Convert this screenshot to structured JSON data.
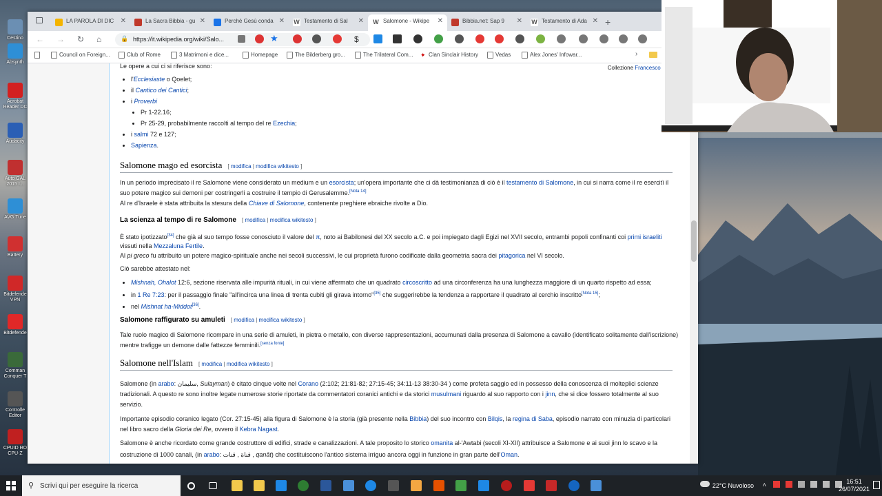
{
  "desktop": {
    "icons": [
      {
        "label": "Cestino",
        "color": "#6b8fb3"
      },
      {
        "label": "Absynth",
        "color": "#2e8fd6"
      },
      {
        "label": "Acrobat Reader DC",
        "color": "#d32020"
      },
      {
        "label": "Audacity",
        "color": "#2b5fb5"
      },
      {
        "label": "Auto GAL 2015 I...",
        "color": "#c03030"
      },
      {
        "label": "AVG Tune",
        "color": "#2e8fd6"
      },
      {
        "label": "Battery",
        "color": "#d03030"
      },
      {
        "label": "Bitdefende VPN",
        "color": "#d02828"
      },
      {
        "label": "Bitdefende",
        "color": "#e02828"
      },
      {
        "label": "Comman Conquer T",
        "color": "#3a6a3a"
      },
      {
        "label": "Controlle Editor",
        "color": "#555555"
      },
      {
        "label": "CPUID RO CPU-Z",
        "color": "#c02020"
      }
    ]
  },
  "browser": {
    "tabs": [
      {
        "title": "LA PAROLA DI DIC",
        "color": "#f4b400"
      },
      {
        "title": "La Sacra Bibbia - gu",
        "color": "#c0392b"
      },
      {
        "title": "Perché Gesù conda",
        "color": "#1a73e8"
      },
      {
        "title": "Testamento di Sal",
        "color": "#555555"
      },
      {
        "title": "Salomone - Wikipe",
        "color": "#555555"
      },
      {
        "title": "Bibbia.net: Sap 9",
        "color": "#c0392b"
      },
      {
        "title": "Testamento di Ada",
        "color": "#555555"
      }
    ],
    "new_tab": "+",
    "url": "https://it.wikipedia.org/wiki/Salo...",
    "bookmarks": [
      "Council on Foreign...",
      "Club of Rome",
      "3 Matrimoni e dice...",
      "Homepage",
      "The Bilderberg gro...",
      "The Trilateral Com...",
      "Clan Sinclair History",
      "Vedas",
      "Alex Jones' Infowar..."
    ]
  },
  "article": {
    "credit_prefix": "Collezione ",
    "credit_link": "Francesco Paolo Fron",
    "intro": "Le opere a cui ci si riferisce sono:",
    "list": [
      {
        "pre": "l'",
        "link": "Ecclesiaste",
        "post": " o Qoelet;"
      },
      {
        "pre": "il ",
        "link": "Cantico dei Cantici",
        "post": ";"
      },
      {
        "pre": "i ",
        "link": "Proverbi",
        "post": ""
      },
      {
        "pre": "i ",
        "link": "salmi",
        "post": " 72 e 127;"
      },
      {
        "pre": "",
        "link": "Sapienza",
        "post": "."
      }
    ],
    "sublist": [
      "Pr 1-22.16;",
      "Pr 25-29, probabilmente raccolti al tempo del re "
    ],
    "sublink": "Ezechia",
    "edit": "modifica",
    "edit2": "modifica wikitesto",
    "s1_title": "Salomone mago ed esorcista",
    "s1_p1a": "In un periodo imprecisato il re Salomone viene considerato un medium e un ",
    "s1_p1l": "esorcista",
    "s1_p1b": "; un'opera importante che ci dà testimonianza di ciò è il ",
    "s1_p1l2": "testamento di Salomone",
    "s1_p1c": ", in cui si narra come il re esercitì il suo potere magico sui demoni per costringerli a costruire il tempio di Gerusalemme.",
    "s1_n1": "[Nota 14]",
    "s1_p2a": "Al re d'Israele è stata attribuita la stesura della ",
    "s1_p2l": "Chiave di Salomone",
    "s1_p2b": ", contenente preghiere ebraiche rivolte a Dio.",
    "s2_title": "La scienza al tempo di re Salomone",
    "s2_p1a": "È stato ipotizzato",
    "s2_n1": "[34]",
    "s2_p1b": " che già al suo tempo fosse conosciuto il valore del ",
    "s2_pi": "π",
    "s2_p1c": ", noto ai Babilonesi del XX secolo a.C. e poi impiegato dagli Egizi nel XVII secolo, entrambi popoli confinanti coi ",
    "s2_l1": "primi israeliti",
    "s2_p1d": " vissuti nella ",
    "s2_l2": "Mezzaluna Fertile",
    "s2_p2a": "Al ",
    "s2_p2i": "pi greco",
    "s2_p2b": " fu attribuito un potere magico-spirituale anche nei secoli successivi, le cui proprietà furono codificate dalla geometria sacra dei ",
    "s2_l3": "pitagorica",
    "s2_p2c": " nel VI secolo.",
    "s2_p3": "Ciò sarebbe attestato nel:",
    "s2_i1l": "Mishnah, Ohalot",
    "s2_i1": " 12:6, sezione riservata alle impurità rituali, in cui viene affermato che un quadrato ",
    "s2_i1l2": "circoscritto",
    "s2_i1b": " ad una circonferenza ha una lunghezza maggiore di un quarto rispetto ad essa;",
    "s2_i2a": "in ",
    "s2_i2l": "1 Re 7:23",
    "s2_i2b": ": per il passaggio finale \"all'incirca una linea di trenta cubiti gli girava intorno\"",
    "s2_n2": "[35]",
    "s2_i2c": " che suggerirebbe la tendenza a rapportare il quadrato al cerchio inscritto",
    "s2_n3": "[Nota 15]",
    "s2_i3a": "nel ",
    "s2_i3l": "Mishnat ha-Middot",
    "s2_n4": "[36]",
    "s3_title": "Salomone raffigurato su amuleti",
    "s3_p": "Tale ruolo magico di Salomone ricompare in una serie di amuleti, in pietra o metallo, con diverse rappresentazioni, accumunati dalla presenza di Salomone a cavallo (identificato solitamente dall'iscrizione) mentre trafigge un demone dalle fattezze femminili.",
    "s3_n": "[senza fonte]",
    "s4_title": "Salomone nell'Islam",
    "s4_p1a": "Salomone (in ",
    "s4_l1": "arabo",
    "s4_p1ar": ": سليمان, ",
    "s4_p1i": "Sulayman",
    "s4_p1b": ") è citato cinque volte nel ",
    "s4_l2": "Corano",
    "s4_p1c": " (2:102; 21:81-82; 27:15-45; 34:11-13 38:30-34 ) come profeta saggio ed in possesso della conoscenza di molteplici scienze tradizionali. A questo re sono inoltre legate numerose storie riportate da commentatori coranici antichi e da storici ",
    "s4_l3": "musulmani",
    "s4_p1d": " riguardo al suo rapporto con i ",
    "s4_l4": "jinn",
    "s4_p1e": ", che si dice fossero totalmente al suo servizio.",
    "s4_p2a": "Importante episodio coranico legato (Cor. 27:15-45) alla figura di Salomone è la storia (già presente nella ",
    "s4_l5": "Bibbia",
    "s4_p2b": ") del suo incontro con ",
    "s4_l6": "Bilqis",
    "s4_p2c": ", la ",
    "s4_l7": "regina di Saba",
    "s4_p2d": ", episodio narrato con minuzia di particolari nel libro sacro della ",
    "s4_p2i": "Gloria dei Re",
    "s4_p2e": ", ovvero il ",
    "s4_l8": "Kebra Nagast",
    "s4_p3a": "Salomone è anche ricordato come grande costruttore di edifici, strade e canalizzazioni. A tale proposito lo storico ",
    "s4_l9": "omanita",
    "s4_p3b": " al-'Awtabi (secoli XI-XII) attribuisce a Salomone e ai suoi jinn lo scavo e la costruzione di 1000 canali, (in ",
    "s4_p3ar": ": قناة , قنات , ",
    "s4_p3i": "qanāt",
    "s4_p3c": ") che costituiscono l'antico sistema irriguo ancora oggi in funzione in gran parte dell'",
    "s4_l10": "Oman"
  },
  "taskbar": {
    "search_placeholder": "Scrivi qui per eseguire la ricerca",
    "weather": "22°C Nuvoloso",
    "time": "16:51",
    "date": "26/07/2021"
  }
}
